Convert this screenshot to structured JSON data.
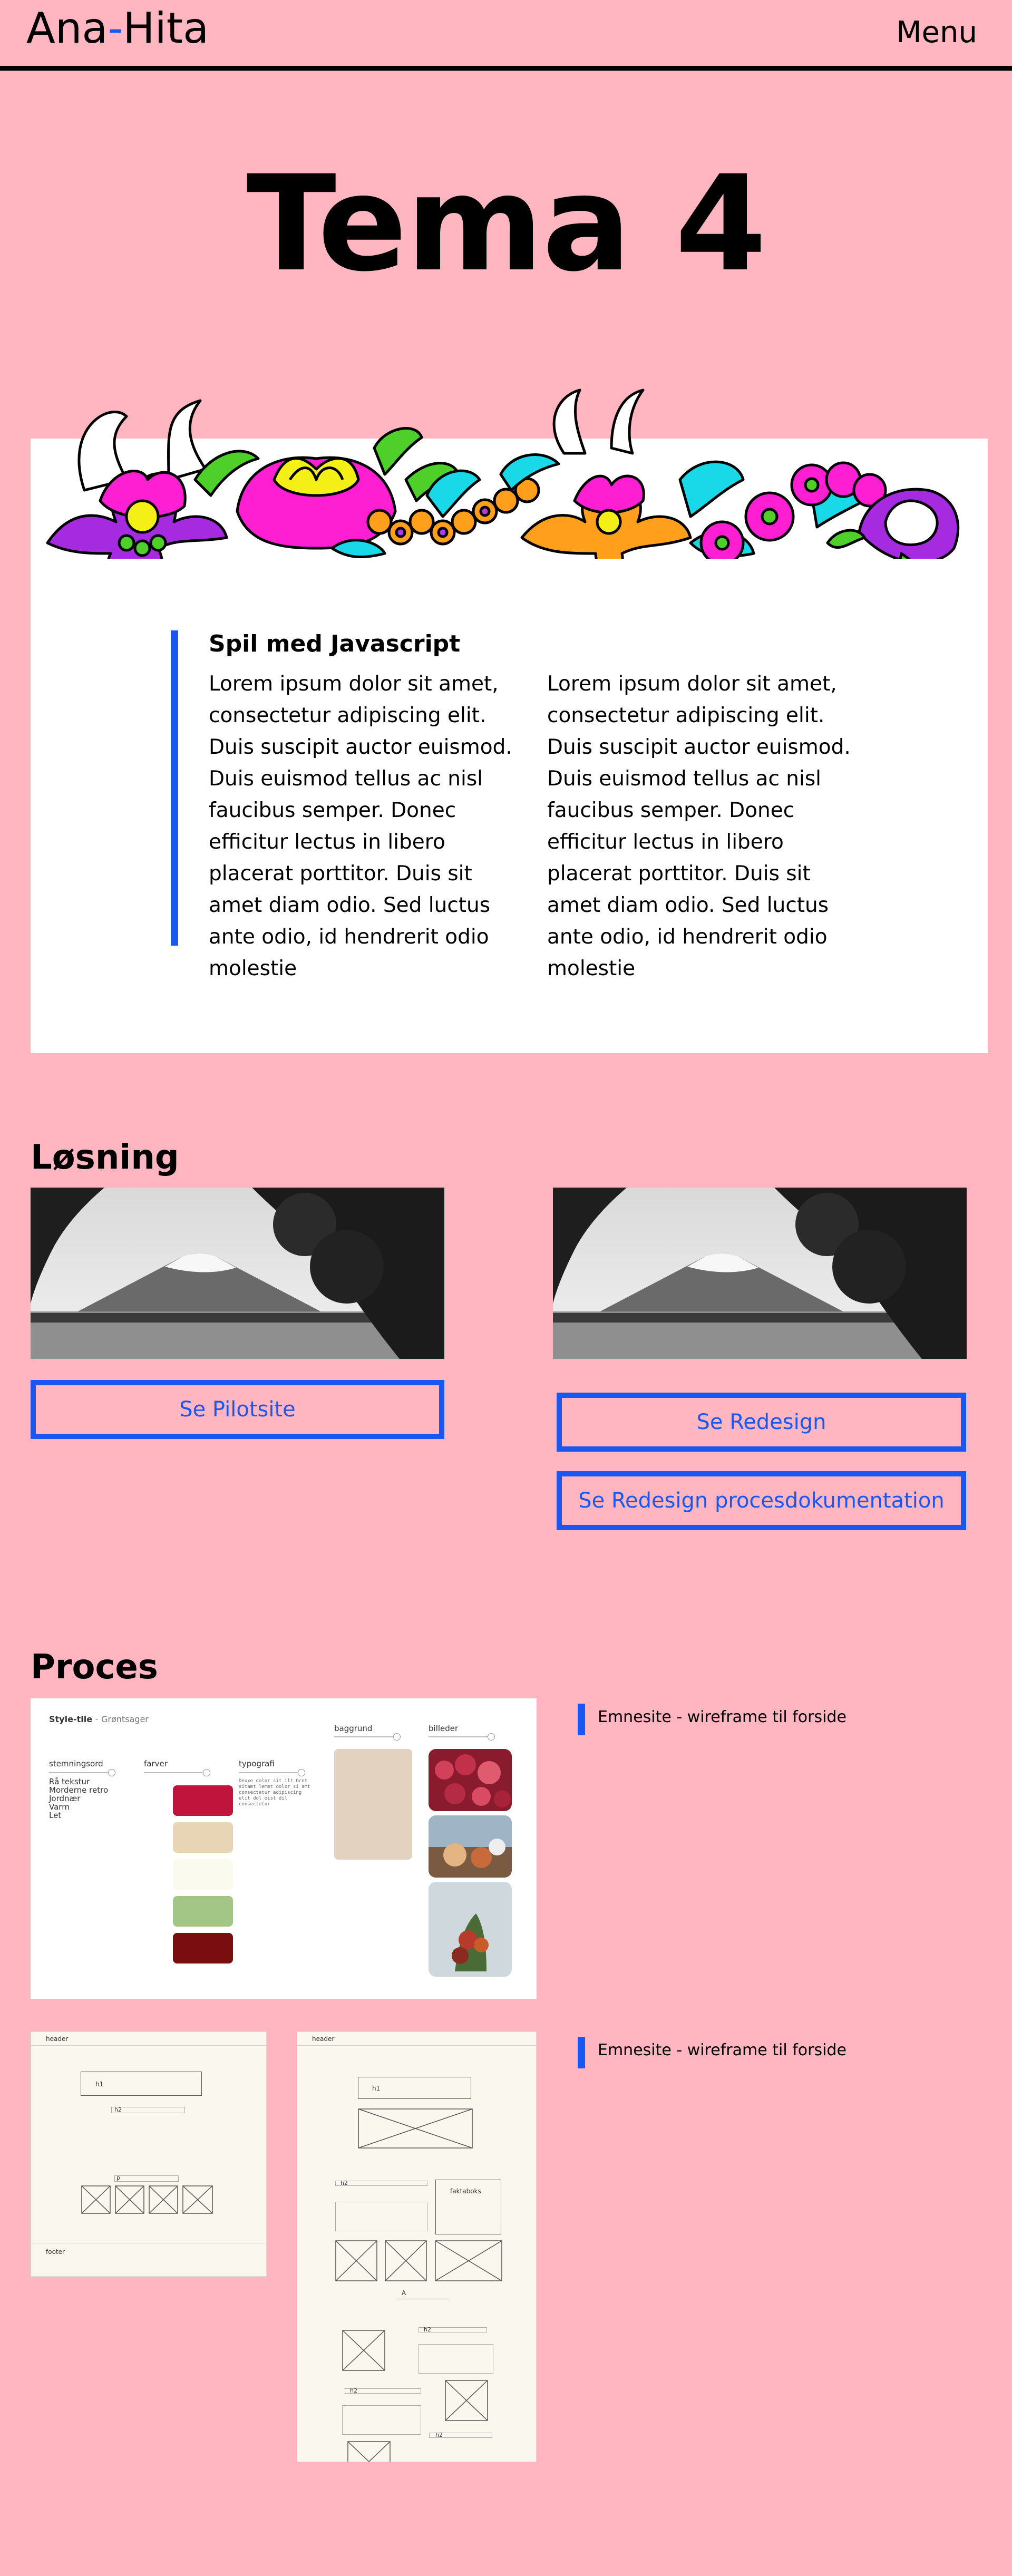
{
  "header": {
    "logo_left": "Ana",
    "logo_dash": "-",
    "logo_right": "Hita",
    "menu_label": "Menu"
  },
  "hero": {
    "title": "Tema 4"
  },
  "article": {
    "heading": "Spil med Javascript",
    "col1": "Lorem ipsum dolor sit amet, consectetur adipiscing elit. Duis suscipit auctor euismod. Duis euismod tellus ac nisl faucibus semper. Donec efficitur lectus in libero placerat porttitor. Duis sit amet diam odio. Sed luctus ante odio, id hendrerit odio molestie",
    "col2": "Lorem ipsum dolor sit amet, consectetur adipiscing elit. Duis suscipit auctor euismod. Duis euismod tellus ac nisl faucibus semper. Donec efficitur lectus in libero placerat porttitor. Duis sit amet diam odio. Sed luctus ante odio, id hendrerit odio molestie"
  },
  "solution": {
    "title": "Løsning",
    "pilot_button": "Se Pilotsite",
    "redesign_button": "Se Redesign",
    "process_doc_button": "Se Redesign procesdokumentation"
  },
  "process": {
    "title": "Proces",
    "caption1": "Emnesite - wireframe til forside",
    "caption2": "Emnesite - wireframe til forside",
    "styletile": {
      "title": "Style-tile",
      "sep": "-",
      "subtitle": "Grøntsager",
      "mood_label": "stemningsord",
      "mood_words": [
        "Rå tekstur",
        "Morderne retro",
        "Jordnær",
        "Varm",
        "Let"
      ],
      "colors_label": "farver",
      "colors": [
        "#C0143C",
        "#E8D5B5",
        "#FBFAEF",
        "#A3C585",
        "#7A0D10"
      ],
      "typography_label": "typografi",
      "typography_sample": "Deuxe dolor sit ilt Ornt sitamt lemmt dolor si amt consectetur adipiscing elit dol oist dil consectetur",
      "background_label": "baggrund",
      "images_label": "billeder"
    },
    "wireframe_small": {
      "header": "header",
      "h1": "h1",
      "h2": "h2",
      "p": "p",
      "footer": "footer"
    },
    "wireframe_tall": {
      "header": "header",
      "h1": "h1",
      "h2_a": "h2",
      "factbox": "faktaboks",
      "h2_b": "h2",
      "a_label": "A",
      "h2_c": "h2",
      "h2_d": "h2",
      "h2_e": "h2"
    }
  }
}
